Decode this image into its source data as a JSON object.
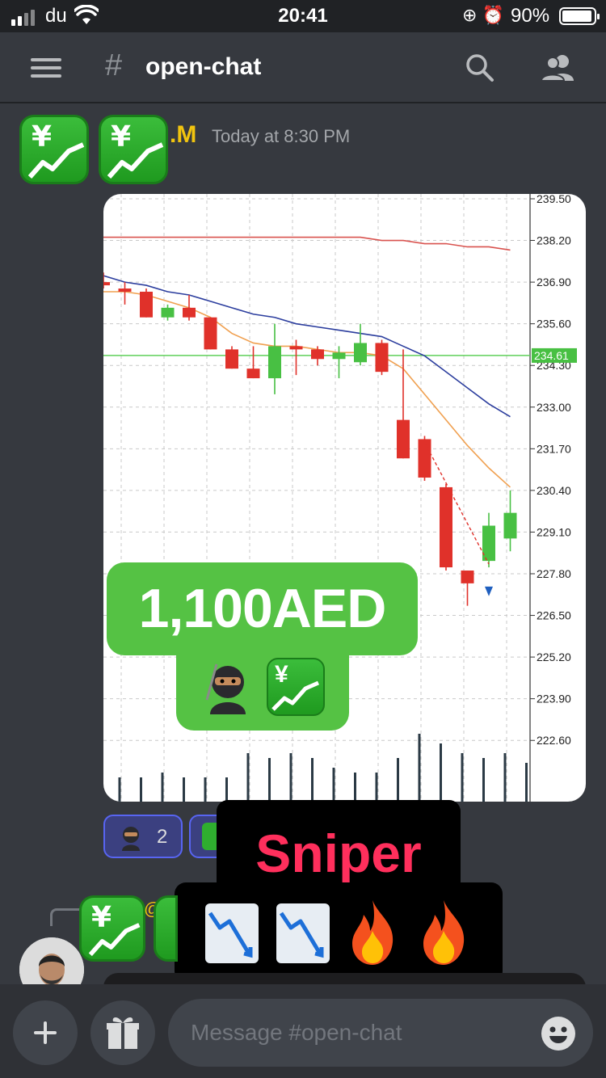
{
  "status_bar": {
    "carrier": "du",
    "time": "20:41",
    "battery_percent": "90%",
    "icons": [
      "signal-icon",
      "wifi-icon",
      "rotation-lock-icon",
      "alarm-icon",
      "battery-icon"
    ]
  },
  "header": {
    "hash": "#",
    "channel_name": "open-chat"
  },
  "messages": [
    {
      "username": ".M",
      "timestamp": "Today at 8:30 PM",
      "sticker": {
        "price": "1,100AED"
      },
      "reactions": [
        {
          "emoji": "ninja",
          "count": "2"
        },
        {
          "emoji": "chart-increasing-with-yen",
          "count": ""
        }
      ],
      "overlay": {
        "title": "Sniper",
        "emojis": [
          "chart-decreasing",
          "chart-decreasing",
          "fire",
          "fire"
        ]
      }
    },
    {
      "reply_mention": "@"
    }
  ],
  "chart_data": {
    "type": "candlestick",
    "price_axis_labels": [
      "239.50",
      "238.20",
      "236.90",
      "235.60",
      "234.30",
      "233.00",
      "231.70",
      "230.40",
      "229.10",
      "227.80",
      "226.50",
      "225.20",
      "223.90",
      "222.60"
    ],
    "current_price": "234.61",
    "y_range": [
      222.0,
      239.5
    ],
    "candles": [
      {
        "o": 236.9,
        "c": 236.8,
        "h": 237.2,
        "l": 236.7
      },
      {
        "o": 236.7,
        "c": 236.6,
        "h": 236.9,
        "l": 236.2
      },
      {
        "o": 236.6,
        "c": 235.8,
        "h": 236.7,
        "l": 235.8
      },
      {
        "o": 235.8,
        "c": 236.1,
        "h": 236.2,
        "l": 235.7
      },
      {
        "o": 236.1,
        "c": 235.8,
        "h": 236.5,
        "l": 235.7
      },
      {
        "o": 235.8,
        "c": 234.8,
        "h": 235.8,
        "l": 234.8
      },
      {
        "o": 234.8,
        "c": 234.2,
        "h": 234.9,
        "l": 234.2
      },
      {
        "o": 234.2,
        "c": 233.9,
        "h": 234.9,
        "l": 233.9
      },
      {
        "o": 233.9,
        "c": 234.9,
        "h": 235.6,
        "l": 233.4
      },
      {
        "o": 234.9,
        "c": 234.8,
        "h": 235.1,
        "l": 234.0
      },
      {
        "o": 234.8,
        "c": 234.5,
        "h": 234.9,
        "l": 234.3
      },
      {
        "o": 234.5,
        "c": 234.7,
        "h": 234.9,
        "l": 233.9
      },
      {
        "o": 234.4,
        "c": 235.0,
        "h": 235.6,
        "l": 234.3
      },
      {
        "o": 235.0,
        "c": 234.1,
        "h": 235.1,
        "l": 234.0
      },
      {
        "o": 232.6,
        "c": 231.4,
        "h": 234.8,
        "l": 231.4
      },
      {
        "o": 232.0,
        "c": 230.8,
        "h": 232.1,
        "l": 230.7
      },
      {
        "o": 230.5,
        "c": 228.0,
        "h": 230.6,
        "l": 227.9
      },
      {
        "o": 227.9,
        "c": 227.5,
        "h": 227.9,
        "l": 226.8
      },
      {
        "o": 228.2,
        "c": 229.3,
        "h": 229.7,
        "l": 228.0
      },
      {
        "o": 228.9,
        "c": 229.7,
        "h": 230.4,
        "l": 228.5
      }
    ],
    "ma_slow_red": [
      238.3,
      238.3,
      238.3,
      238.3,
      238.3,
      238.3,
      238.3,
      238.3,
      238.3,
      238.3,
      238.3,
      238.3,
      238.3,
      238.2,
      238.2,
      238.1,
      238.1,
      238.0,
      238.0,
      237.9
    ],
    "ma_mid_blue": [
      237.1,
      236.9,
      236.8,
      236.6,
      236.5,
      236.3,
      236.1,
      235.9,
      235.8,
      235.6,
      235.5,
      235.4,
      235.3,
      235.2,
      234.9,
      234.6,
      234.1,
      233.6,
      233.1,
      232.7
    ],
    "ma_fast_orange": [
      236.6,
      236.6,
      236.5,
      236.3,
      236.1,
      235.8,
      235.3,
      235.0,
      234.9,
      234.9,
      234.8,
      234.7,
      234.7,
      234.6,
      234.2,
      233.4,
      232.6,
      231.8,
      231.1,
      230.5
    ],
    "volume": [
      30,
      30,
      36,
      30,
      30,
      30,
      60,
      54,
      60,
      54,
      42,
      36,
      36,
      54,
      84,
      72,
      60,
      54,
      60,
      48
    ]
  },
  "composer": {
    "placeholder": "Message #open-chat"
  },
  "colors": {
    "background": "#36393f",
    "header_text": "#ffffff",
    "username": "#f1c40f",
    "candle_up": "#48c043",
    "candle_down": "#e0312a",
    "sticker_green": "#55c244",
    "sniper_red": "#ff2f5c"
  }
}
